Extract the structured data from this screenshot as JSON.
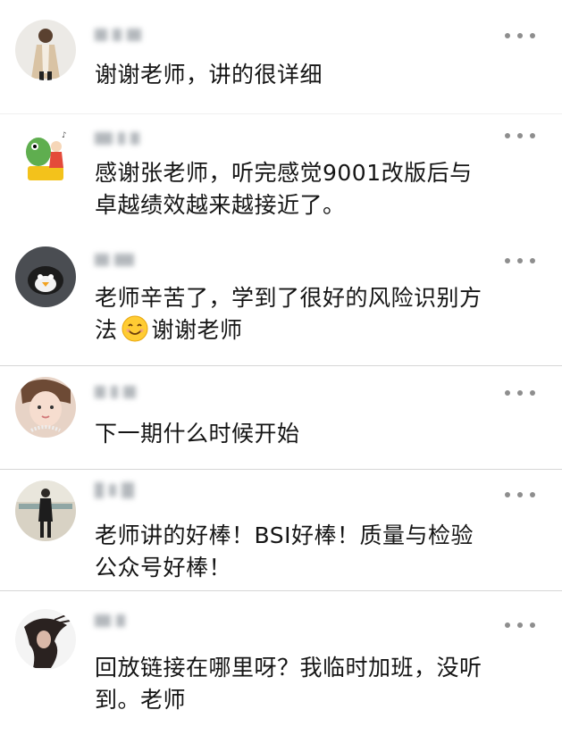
{
  "comments": [
    {
      "author": "",
      "lines": [
        "谢谢老师，讲的很详细"
      ],
      "avatar": "avatar-woman-coat-icon",
      "more_icon": "more-dots-icon"
    },
    {
      "author": "",
      "lines": [
        "感谢张老师，听完感觉9001改版后与",
        "卓越绩效越来越接近了。"
      ],
      "avatar": "avatar-cartoon-icon",
      "more_icon": "more-dots-icon"
    },
    {
      "author": "",
      "lines_parts": [
        "老师辛苦了，学到了很好的风险识别方",
        "法",
        "谢谢老师"
      ],
      "avatar": "avatar-penguin-icon",
      "emoji": "smiling-face-emoji-icon",
      "more_icon": "more-dots-icon"
    },
    {
      "author": "",
      "lines": [
        "下一期什么时候开始"
      ],
      "avatar": "avatar-girl-face-icon",
      "more_icon": "more-dots-icon"
    },
    {
      "author": "",
      "lines": [
        "老师讲的好棒！BSI好棒！质量与检验",
        "公众号好棒！"
      ],
      "avatar": "avatar-woman-standing-icon",
      "more_icon": "more-dots-icon"
    },
    {
      "author": "",
      "lines": [
        "回放链接在哪里呀？我临时加班，没听",
        "到。老师"
      ],
      "avatar": "avatar-woman-hair-icon",
      "more_icon": "more-dots-icon"
    }
  ],
  "colors": {
    "background": "#ffffff",
    "divider": "#d6d6d6",
    "text": "#151515",
    "dots": "#8e8e8e"
  }
}
